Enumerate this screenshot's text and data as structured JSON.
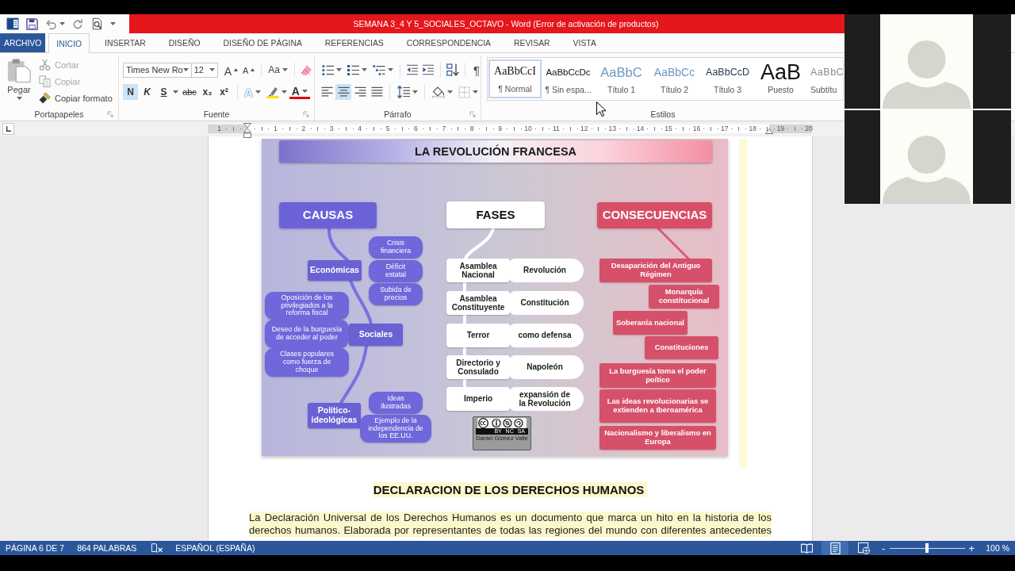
{
  "window": {
    "title": "SEMANA 3_4 Y 5_SOCIALES_OCTAVO - Word (Error de activación de productos)"
  },
  "tabs": [
    {
      "label": "ARCHIVO",
      "kind": "file",
      "selected": false
    },
    {
      "label": "INICIO",
      "kind": "tab",
      "selected": true
    },
    {
      "label": "INSERTAR",
      "kind": "tab",
      "selected": false
    },
    {
      "label": "DISEÑO",
      "kind": "tab",
      "selected": false
    },
    {
      "label": "DISEÑO DE PÁGINA",
      "kind": "tab",
      "selected": false
    },
    {
      "label": "REFERENCIAS",
      "kind": "tab",
      "selected": false
    },
    {
      "label": "CORRESPONDENCIA",
      "kind": "tab",
      "selected": false
    },
    {
      "label": "REVISAR",
      "kind": "tab",
      "selected": false
    },
    {
      "label": "VISTA",
      "kind": "tab",
      "selected": false
    }
  ],
  "ribbon": {
    "clipboard": {
      "label": "Portapapeles",
      "paste": "Pegar",
      "commands": [
        {
          "label": "Cortar",
          "kind": "cut",
          "disabled": true
        },
        {
          "label": "Copiar",
          "kind": "copy",
          "disabled": true
        },
        {
          "label": "Copiar formato",
          "kind": "format_painter",
          "disabled": false
        }
      ]
    },
    "font": {
      "label": "Fuente",
      "font_name": "Times New Ro",
      "font_size": "12",
      "grow": "A",
      "shrink": "A",
      "change_case": "Aa",
      "formatting": [
        {
          "label": "N",
          "kind": "bold",
          "selected": true
        },
        {
          "label": "K",
          "kind": "italic",
          "selected": false
        },
        {
          "label": "S",
          "kind": "underline",
          "selected": false
        },
        {
          "label": "abc",
          "kind": "strikethrough",
          "selected": false
        },
        {
          "label": "x₂",
          "kind": "subscript",
          "selected": false
        },
        {
          "label": "x²",
          "kind": "superscript",
          "selected": false
        }
      ],
      "text_effects": "A",
      "font_color": "A"
    },
    "paragraph": {
      "label": "Párrafo",
      "show_marks": "¶",
      "alignment": [
        {
          "kind": "left",
          "selected": false
        },
        {
          "kind": "center",
          "selected": true
        },
        {
          "kind": "right",
          "selected": false
        },
        {
          "kind": "justify",
          "selected": false
        }
      ]
    },
    "styles": {
      "label": "Estilos",
      "items": [
        {
          "preview": "AaBbCcI",
          "name": "¶ Normal",
          "kind": "normal",
          "selected": true
        },
        {
          "preview": "AaBbCcDc",
          "name": "¶ Sin espa...",
          "kind": "no_spacing",
          "selected": false
        },
        {
          "preview": "AaBbC",
          "name": "Título 1",
          "kind": "heading1",
          "selected": false
        },
        {
          "preview": "AaBbCc",
          "name": "Título 2",
          "kind": "heading2",
          "selected": false
        },
        {
          "preview": "AaBbCcD",
          "name": "Título 3",
          "kind": "heading3",
          "selected": false
        },
        {
          "preview": "AaB",
          "name": "Puesto",
          "kind": "title",
          "selected": false
        },
        {
          "preview": "AaBbC",
          "name": "Subtítu",
          "kind": "subtitle",
          "selected": false
        }
      ]
    }
  },
  "ruler": {
    "numbers": [
      "1",
      "1",
      "2",
      "3",
      "4",
      "5",
      "6",
      "7",
      "8",
      "9",
      "10",
      "11",
      "12",
      "13",
      "14",
      "15",
      "16",
      "17",
      "18",
      "19",
      "20"
    ]
  },
  "document": {
    "concept_map": {
      "title": "LA REVOLUCIÓN FRANCESA",
      "causes": {
        "heading": "CAUSAS",
        "groups": [
          {
            "label": "Económicas",
            "items": [
              "Crisis financiera",
              "Déficit estatal",
              "Subida de precios"
            ]
          },
          {
            "label": "Sociales",
            "items": [
              "Oposición de los privilegiados a la reforma fiscal",
              "Deseo de la burguesía de acceder al poder",
              "Clases populares como fuerza de choque"
            ]
          },
          {
            "label": "Político-ideológicas",
            "items": [
              "Ideas ilustradas",
              "Ejemplo de la independencia de los EE.UU."
            ]
          }
        ]
      },
      "phases": {
        "heading": "FASES",
        "rows": [
          {
            "phase": "Asamblea Nacional",
            "note": "Revolución"
          },
          {
            "phase": "Asamblea Constituyente",
            "note": "Constitución"
          },
          {
            "phase": "Terror",
            "note": "como defensa"
          },
          {
            "phase": "Directorio y Consulado",
            "note": "Napoleón"
          },
          {
            "phase": "Imperio",
            "note": "expansión de la Revolución"
          }
        ]
      },
      "consequences": {
        "heading": "CONSECUENCIAS",
        "items": [
          "Desaparición del Antiguo Régimen",
          "Monarquía constitucional",
          "Soberanía nacional",
          "Constituciones",
          "La burguesía toma el poder poítico",
          "Las ideas revolucionarias se extienden a Iberoamérica",
          "Nacionalismo y liberalismo en Europa"
        ]
      },
      "license": {
        "terms": "BY NC SA",
        "author": "Daniel Gómez Valle"
      }
    },
    "image_line_highlighted": true,
    "heading": {
      "text": "DECLARACION DE LOS DERECHOS HUMANOS",
      "highlighted": true
    },
    "paragraph": {
      "text": "La Declaración Universal de los Derechos Humanos es un documento que marca un hito en la historia de los derechos humanos. Elaborada por representantes de todas las regiones del mundo con diferentes antecedentes",
      "highlighted": true
    }
  },
  "status_bar": {
    "page": "PÁGINA 6 DE 7",
    "words": "864 PALABRAS",
    "language": "ESPAÑOL (ESPAÑA)",
    "views": [
      {
        "kind": "read",
        "selected": false
      },
      {
        "kind": "print",
        "selected": true
      },
      {
        "kind": "web",
        "selected": false
      }
    ],
    "zoom_out": "-",
    "zoom_in": "+",
    "zoom": {
      "level": 0.49,
      "reading": "100 %"
    }
  },
  "video_tiles": [
    {
      "camera_on": false
    },
    {
      "camera_on": false
    }
  ]
}
